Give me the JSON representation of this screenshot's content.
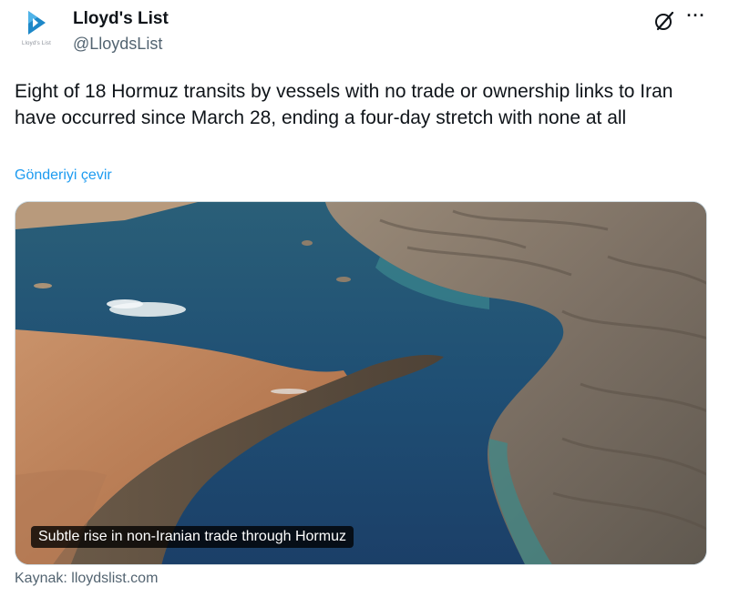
{
  "author": {
    "display_name": "Lloyd's List",
    "handle": "@LloydsList",
    "avatar_caption": "Lloyd's List"
  },
  "tweet": {
    "text": "Eight of 18 Hormuz transits by vessels with no trade or ownership links to Iran have occurred since March 28, ending a four-day stretch with none at all",
    "translate_label": "Gönderiyi çevir"
  },
  "media": {
    "caption": "Subtle rise in non-Iranian trade through Hormuz"
  },
  "card": {
    "source_label": "Kaynak: lloydslist.com"
  },
  "icons": {
    "grok": "grok-icon",
    "more": "more-options-icon"
  },
  "colors": {
    "link": "#1d9bf0",
    "secondary_text": "#536471",
    "brand_blue": "#1e88c8"
  }
}
